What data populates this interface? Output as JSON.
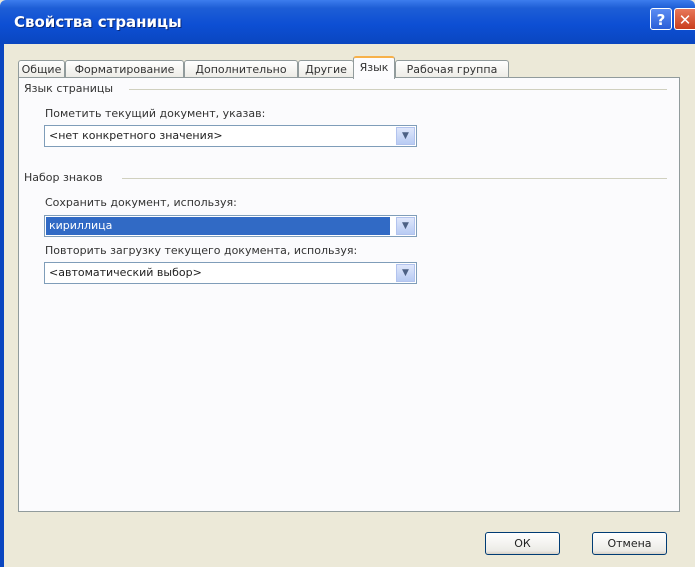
{
  "window": {
    "title": "Свойства страницы",
    "help_glyph": "?",
    "close_glyph": "✕"
  },
  "tabs": [
    {
      "label": "Общие",
      "active": false
    },
    {
      "label": "Форматирование",
      "active": false
    },
    {
      "label": "Дополнительно",
      "active": false
    },
    {
      "label": "Другие",
      "active": false
    },
    {
      "label": "Язык",
      "active": true
    },
    {
      "label": "Рабочая группа",
      "active": false
    }
  ],
  "page_language": {
    "group_title": "Язык страницы",
    "mark_label": "Пометить текущий документ, указав:",
    "mark_value": "<нет конкретного значения>"
  },
  "charset": {
    "group_title": "Набор знаков",
    "save_label": "Сохранить документ, используя:",
    "save_value": "кириллица",
    "reload_label": "Повторить загрузку текущего документа, используя:",
    "reload_value": "<автоматический выбор>"
  },
  "buttons": {
    "ok": "ОК",
    "cancel": "Отмена"
  },
  "icons": {
    "dropdown": "▼"
  },
  "colors": {
    "title_bar": "#0d4fd4",
    "selection": "#316ac5",
    "active_tab_accent": "#f7b14a"
  }
}
